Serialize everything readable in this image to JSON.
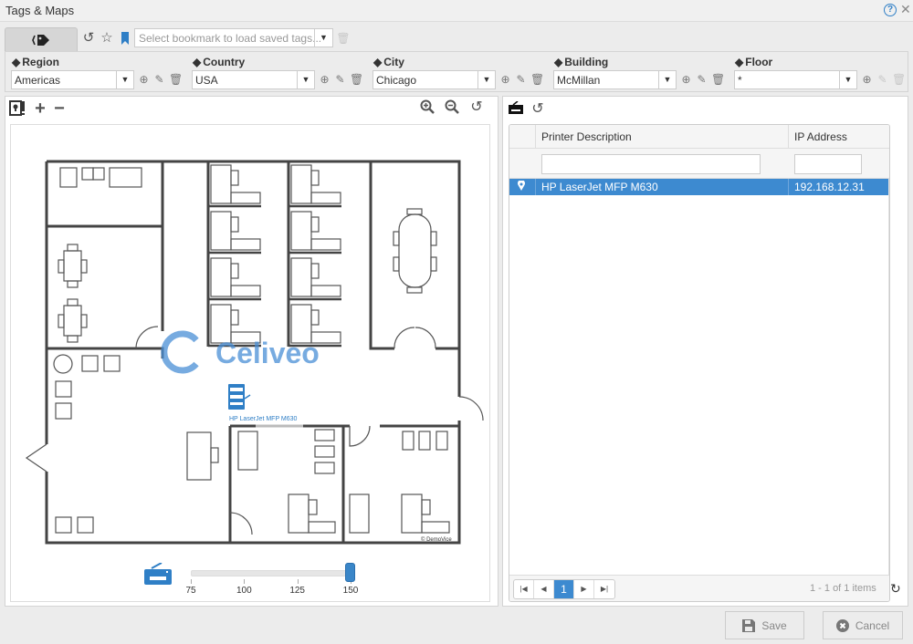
{
  "window": {
    "title": "Tags & Maps",
    "help_icon": "question-circle-icon",
    "close_icon": "close-icon"
  },
  "toolbar": {
    "tag_tab_icon": "tags-icon",
    "reset_icon": "undo-icon",
    "favorite_icon": "star-icon",
    "bookmark_icon": "bookmark-icon",
    "bookmark_placeholder": "Select bookmark to load saved tags...",
    "delete_icon": "trash-icon"
  },
  "filters": [
    {
      "label": "Region",
      "value": "Americas",
      "actions": {
        "add": true,
        "edit": true,
        "delete": true
      }
    },
    {
      "label": "Country",
      "value": "USA",
      "actions": {
        "add": true,
        "edit": true,
        "delete": true
      }
    },
    {
      "label": "City",
      "value": "Chicago",
      "actions": {
        "add": true,
        "edit": true,
        "delete": true
      }
    },
    {
      "label": "Building",
      "value": "McMillan",
      "actions": {
        "add": true,
        "edit": true,
        "delete": true
      }
    },
    {
      "label": "Floor",
      "value": "*",
      "actions": {
        "add": true,
        "edit": false,
        "delete": false
      }
    }
  ],
  "map": {
    "toolbar_left": [
      "map-marker-toggle-icon",
      "plus-icon",
      "minus-icon"
    ],
    "toolbar_right": [
      "zoom-in-icon",
      "zoom-out-icon",
      "reset-icon"
    ],
    "watermark": "Celiveo",
    "printer_marker_label": "HP LaserJet MFP M630",
    "copyright": "© DemoVice",
    "icon_size_slider": {
      "ticks": [
        "75",
        "100",
        "125",
        "150"
      ],
      "min": 75,
      "max": 150,
      "value": 150
    }
  },
  "grid": {
    "toolbar": [
      "printer-icon",
      "refresh-icon"
    ],
    "columns": [
      "Printer Description",
      "IP Address"
    ],
    "filters": {
      "description": "",
      "ip": ""
    },
    "rows": [
      {
        "located": true,
        "description": "HP LaserJet MFP M630",
        "ip": "192.168.12.31",
        "selected": true
      }
    ],
    "pager": {
      "current_page": "1",
      "info": "1 - 1 of 1 items"
    }
  },
  "footer": {
    "save_label": "Save",
    "cancel_label": "Cancel"
  }
}
